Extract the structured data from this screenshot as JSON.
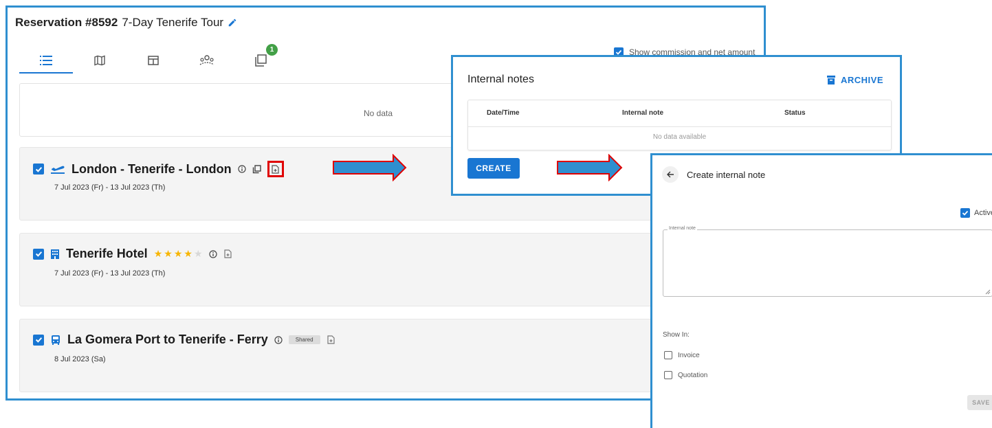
{
  "reservation": {
    "number_label": "Reservation #8592",
    "tour_name": "7-Day Tenerife Tour",
    "tabs": [
      {
        "icon": "list-icon",
        "active": true
      },
      {
        "icon": "map-icon",
        "active": false
      },
      {
        "icon": "table-icon",
        "active": false
      },
      {
        "icon": "group-icon",
        "active": false
      },
      {
        "icon": "copy-documents-icon",
        "active": false,
        "badge": "1"
      }
    ],
    "commission_label": "Show commission and net amount",
    "commission_checked": true,
    "no_data": "No data",
    "items": [
      {
        "icon": "flight-icon",
        "title": "London - Tenerife - London",
        "dates": "7 Jul 2023 (Fr) - 13 Jul 2023 (Th)"
      },
      {
        "icon": "hotel-icon",
        "title": "Tenerife Hotel",
        "stars": 4,
        "star_max": 5,
        "dates": "7 Jul 2023 (Fr) - 13 Jul 2023 (Th)"
      },
      {
        "icon": "bus-icon",
        "title": "La Gomera Port to Tenerife - Ferry",
        "tag": "Shared",
        "dates": "8 Jul 2023 (Sa)"
      }
    ]
  },
  "internal_notes": {
    "title": "Internal notes",
    "archive_label": "ARCHIVE",
    "columns": [
      "Date/Time",
      "Internal note",
      "Status"
    ],
    "empty_text": "No data available",
    "create_label": "CREATE"
  },
  "create_note": {
    "title": "Create internal note",
    "active_label": "Active",
    "active_checked": true,
    "field_label": "Internal note",
    "field_value": "",
    "show_in_label": "Show In:",
    "options": [
      {
        "label": "Invoice",
        "checked": false
      },
      {
        "label": "Quotation",
        "checked": false
      }
    ],
    "save_label": "SAVE"
  },
  "colors": {
    "accent": "#1976d2",
    "panel_border": "#2f8fd0",
    "highlight": "#e00000",
    "arrow_fill": "#2f8fd0",
    "badge": "#43a047",
    "star": "#f7b500"
  }
}
